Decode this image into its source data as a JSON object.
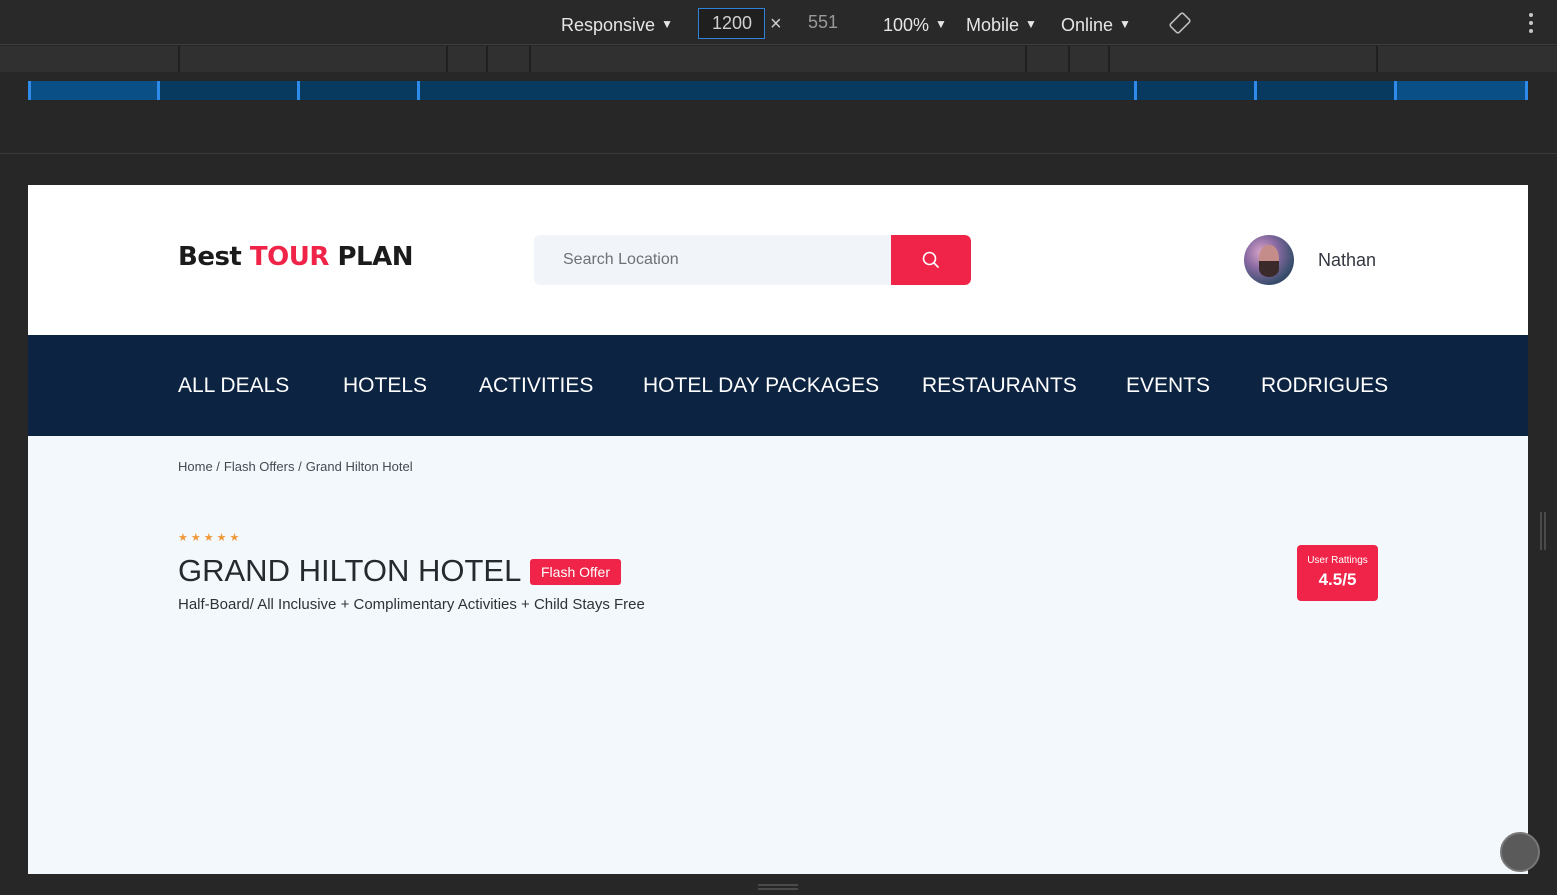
{
  "devtools": {
    "device_mode": "Responsive",
    "width_value": "1200",
    "times": "×",
    "height_value": "551",
    "zoom": "100%",
    "throttle_device": "Mobile",
    "network": "Online",
    "caret": "▼"
  },
  "site": {
    "logo": {
      "part1": "Best ",
      "part2": "TOUR",
      "part3": " PLAN"
    },
    "search": {
      "placeholder": "Search Location"
    },
    "user": {
      "name": "Nathan"
    },
    "nav": [
      "ALL DEALS",
      "HOTELS",
      "ACTIVITIES",
      "HOTEL DAY PACKAGES",
      "RESTAURANTS",
      "EVENTS",
      "RODRIGUES"
    ],
    "breadcrumb": [
      "Home /",
      "Flash Offers /",
      "Grand Hilton Hotel"
    ],
    "hotel": {
      "stars": "★★★★★",
      "star_count": 5,
      "title": "GRAND HILTON HOTEL",
      "badge": "Flash Offer",
      "subtitle": "Half-Board/ All Inclusive + Complimentary Activities + Child Stays Free",
      "rating_label": "User Rattings",
      "rating_value": "4.5/5"
    }
  },
  "colors": {
    "accent": "#ef2448",
    "nav_bg": "#0c2341",
    "star": "#f0983a",
    "devtools_bg": "#292929",
    "mq_bar": "#083a60"
  }
}
